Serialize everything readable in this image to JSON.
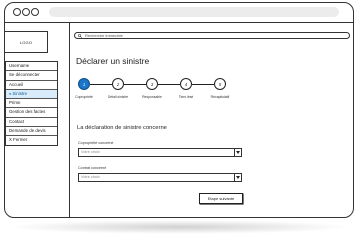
{
  "sidebar": {
    "logo": "LOGO",
    "items": [
      {
        "label": "Username"
      },
      {
        "label": "Se déconnecter"
      },
      {
        "label": "Accueil"
      },
      {
        "prefix": "●",
        "label": "Sinistre"
      },
      {
        "label": "Prime"
      },
      {
        "label": "Gestion des factes"
      },
      {
        "label": "Contact"
      },
      {
        "label": "Demande de devis"
      },
      {
        "prefix": "X",
        "label": "Fermer"
      }
    ]
  },
  "search": {
    "placeholder": "Recherche immeuble"
  },
  "page": {
    "title": "Déclarer un sinistre"
  },
  "steps": [
    {
      "number": "1",
      "label": "Copropriété"
    },
    {
      "number": "2",
      "label": "Détail sinistre"
    },
    {
      "number": "3",
      "label": "Responsable"
    },
    {
      "number": "4",
      "label": "Tiers lésé"
    },
    {
      "number": "5",
      "label": "Récapitulatif"
    }
  ],
  "form": {
    "section_title": "La déclaration de sinistre concerne",
    "field1_label": "Copropriété concerné",
    "field1_value": "Votre choix",
    "field2_label": "Contrat concerné",
    "field2_value": "Votre choix",
    "next_button": "Etape suivante"
  }
}
